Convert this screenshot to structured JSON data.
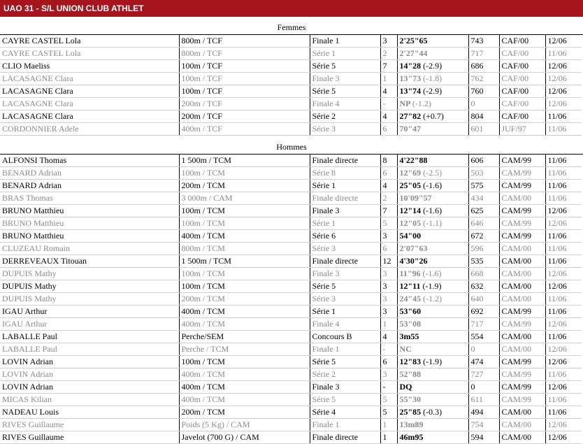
{
  "header": {
    "title": "UAO 31 - S/L UNION CLUB ATHLET"
  },
  "sections": [
    {
      "title": "Femmes",
      "rows": [
        {
          "name": "CAYRE CASTEL Lola",
          "event": "800m / TCF",
          "round": "Finale 1",
          "place": "3",
          "perf": "2'25\"65",
          "wind": "",
          "points": "743",
          "cat": "CAF/00",
          "date": "12/06"
        },
        {
          "name": "CAYRE CASTEL Lola",
          "event": "800m / TCF",
          "round": "Série 1",
          "place": "2",
          "perf": "2'27\"44",
          "wind": "",
          "points": "717",
          "cat": "CAF/00",
          "date": "11/06"
        },
        {
          "name": "CLIO Maeliss",
          "event": "100m / TCF",
          "round": "Série 5",
          "place": "7",
          "perf": "14\"28",
          "wind": "(-2.9)",
          "points": "686",
          "cat": "CAF/00",
          "date": "12/06"
        },
        {
          "name": "LACASAGNE Clara",
          "event": "100m / TCF",
          "round": "Finale 3",
          "place": "1",
          "perf": "13\"73",
          "wind": "(-1.8)",
          "points": "762",
          "cat": "CAF/00",
          "date": "12/06"
        },
        {
          "name": "LACASAGNE Clara",
          "event": "100m / TCF",
          "round": "Série 5",
          "place": "4",
          "perf": "13\"74",
          "wind": "(-2.9)",
          "points": "760",
          "cat": "CAF/00",
          "date": "12/06"
        },
        {
          "name": "LACASAGNE Clara",
          "event": "200m / TCF",
          "round": "Finale 4",
          "place": "-",
          "perf": "NP",
          "wind": "(-1.2)",
          "points": "0",
          "cat": "CAF/00",
          "date": "12/06"
        },
        {
          "name": "LACASAGNE Clara",
          "event": "200m / TCF",
          "round": "Série 2",
          "place": "4",
          "perf": "27\"82",
          "wind": "(+0.7)",
          "points": "804",
          "cat": "CAF/00",
          "date": "11/06"
        },
        {
          "name": "CORDONNIER Adele",
          "event": "400m / TCF",
          "round": "Série 3",
          "place": "6",
          "perf": "70\"47",
          "wind": "",
          "points": "601",
          "cat": "JUF/97",
          "date": "11/06"
        }
      ]
    },
    {
      "title": "Hommes",
      "rows": [
        {
          "name": "ALFONSI Thomas",
          "event": "1 500m / TCM",
          "round": "Finale directe",
          "place": "8",
          "perf": "4'22\"88",
          "wind": "",
          "points": "606",
          "cat": "CAM/99",
          "date": "11/06"
        },
        {
          "name": "BENARD Adrian",
          "event": "100m / TCM",
          "round": "Série 8",
          "place": "6",
          "perf": "12\"69",
          "wind": "(-2.5)",
          "points": "503",
          "cat": "CAM/99",
          "date": "11/06"
        },
        {
          "name": "BENARD Adrian",
          "event": "200m / TCM",
          "round": "Série 1",
          "place": "4",
          "perf": "25\"05",
          "wind": "(-1.6)",
          "points": "575",
          "cat": "CAM/99",
          "date": "11/06"
        },
        {
          "name": "BRAS Thomas",
          "event": "3 000m / CAM",
          "round": "Finale directe",
          "place": "2",
          "perf": "10'09\"57",
          "wind": "",
          "points": "434",
          "cat": "CAM/00",
          "date": "11/06"
        },
        {
          "name": "BRUNO Matthieu",
          "event": "100m / TCM",
          "round": "Finale 3",
          "place": "7",
          "perf": "12\"14",
          "wind": "(-1.6)",
          "points": "625",
          "cat": "CAM/99",
          "date": "12/06"
        },
        {
          "name": "BRUNO Matthieu",
          "event": "100m / TCM",
          "round": "Série 1",
          "place": "5",
          "perf": "12\"05",
          "wind": "(-1.1)",
          "points": "646",
          "cat": "CAM/99",
          "date": "12/06"
        },
        {
          "name": "BRUNO Matthieu",
          "event": "400m / TCM",
          "round": "Série 6",
          "place": "3",
          "perf": "54\"00",
          "wind": "",
          "points": "672",
          "cat": "CAM/99",
          "date": "11/06"
        },
        {
          "name": "CLUZEAU Romain",
          "event": "800m / TCM",
          "round": "Série 3",
          "place": "6",
          "perf": "2'07\"63",
          "wind": "",
          "points": "596",
          "cat": "CAM/00",
          "date": "11/06"
        },
        {
          "name": "DERREVEAUX Titouan",
          "event": "1 500m / TCM",
          "round": "Finale directe",
          "place": "12",
          "perf": "4'30\"26",
          "wind": "",
          "points": "535",
          "cat": "CAM/00",
          "date": "11/06"
        },
        {
          "name": "DUPUIS Mathy",
          "event": "100m / TCM",
          "round": "Finale 3",
          "place": "3",
          "perf": "11\"96",
          "wind": "(-1.6)",
          "points": "668",
          "cat": "CAM/00",
          "date": "12/06"
        },
        {
          "name": "DUPUIS Mathy",
          "event": "100m / TCM",
          "round": "Série 5",
          "place": "3",
          "perf": "12\"11",
          "wind": "(-1.9)",
          "points": "632",
          "cat": "CAM/00",
          "date": "12/06"
        },
        {
          "name": "DUPUIS Mathy",
          "event": "200m / TCM",
          "round": "Série 3",
          "place": "3",
          "perf": "24\"45",
          "wind": "(-1.2)",
          "points": "640",
          "cat": "CAM/00",
          "date": "11/06"
        },
        {
          "name": "IGAU Arthur",
          "event": "400m / TCM",
          "round": "Série 1",
          "place": "3",
          "perf": "53\"60",
          "wind": "",
          "points": "692",
          "cat": "CAM/99",
          "date": "11/06"
        },
        {
          "name": "IGAU Arthur",
          "event": "400m / TCM",
          "round": "Finale 4",
          "place": "1",
          "perf": "53\"08",
          "wind": "",
          "points": "717",
          "cat": "CAM/99",
          "date": "12/06"
        },
        {
          "name": "LABALLE Paul",
          "event": "Perche/SEM",
          "round": "Concours B",
          "place": "4",
          "perf": "3m55",
          "wind": "",
          "points": "554",
          "cat": "CAM/00",
          "date": "11/06"
        },
        {
          "name": "LABALLE Paul",
          "event": "Perche / TCM",
          "round": "Finale 1",
          "place": "-",
          "perf": "NC",
          "wind": "",
          "points": "0",
          "cat": "CAM/00",
          "date": "12/06"
        },
        {
          "name": "LOVIN Adrian",
          "event": "100m / TCM",
          "round": "Série 5",
          "place": "6",
          "perf": "12\"83",
          "wind": "(-1.9)",
          "points": "474",
          "cat": "CAM/99",
          "date": "12/06"
        },
        {
          "name": "LOVIN Adrian",
          "event": "400m / TCM",
          "round": "Série 2",
          "place": "3",
          "perf": "52\"88",
          "wind": "",
          "points": "727",
          "cat": "CAM/99",
          "date": "11/06"
        },
        {
          "name": "LOVIN Adrian",
          "event": "400m / TCM",
          "round": "Finale 3",
          "place": "-",
          "perf": "DQ",
          "wind": "",
          "points": "0",
          "cat": "CAM/99",
          "date": "12/06"
        },
        {
          "name": "MICAS Kilian",
          "event": "400m / TCM",
          "round": "Série 5",
          "place": "5",
          "perf": "55\"30",
          "wind": "",
          "points": "611",
          "cat": "CAM/99",
          "date": "11/06"
        },
        {
          "name": "NADEAU Louis",
          "event": "200m / TCM",
          "round": "Série 4",
          "place": "5",
          "perf": "25\"85",
          "wind": "(-0.3)",
          "points": "494",
          "cat": "CAM/00",
          "date": "11/06"
        },
        {
          "name": "RIVES Guillaume",
          "event": "Poids (5 Kg) / CAM",
          "round": "Finale 1",
          "place": "1",
          "perf": "13m89",
          "wind": "",
          "points": "754",
          "cat": "CAM/00",
          "date": "12/06"
        },
        {
          "name": "RIVES Guillaume",
          "event": "Javelot (700 G) / CAM",
          "round": "Finale directe",
          "place": "1",
          "perf": "46m95",
          "wind": "",
          "points": "594",
          "cat": "CAM/00",
          "date": "12/06"
        }
      ]
    }
  ]
}
